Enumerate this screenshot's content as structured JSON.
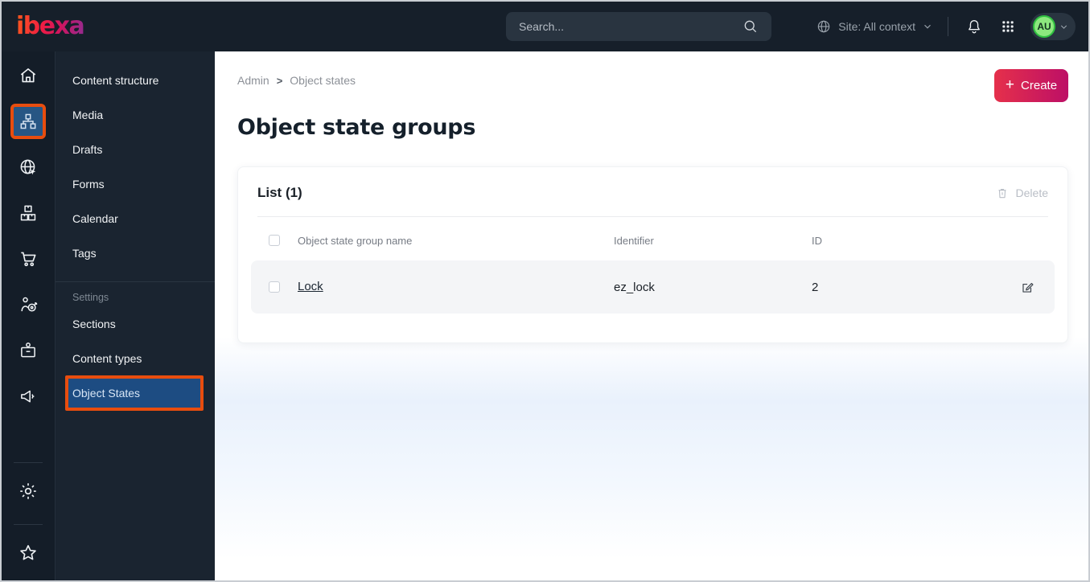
{
  "topbar": {
    "logo": "ibexa",
    "search_placeholder": "Search...",
    "site_context": "Site: All context",
    "avatar_initials": "AU"
  },
  "sidebar": {
    "icons": [
      "home",
      "content-structure",
      "site",
      "product-catalog",
      "commerce",
      "personalization",
      "customers",
      "marketing",
      "settings",
      "bookmarks"
    ],
    "active_icon": "content-structure"
  },
  "menu": {
    "items": [
      "Content structure",
      "Media",
      "Drafts",
      "Forms",
      "Calendar",
      "Tags"
    ],
    "section_label": "Settings",
    "settings_items": [
      "Sections",
      "Content types",
      "Object States"
    ],
    "active_item": "Object States"
  },
  "main": {
    "breadcrumb": [
      "Admin",
      "Object states"
    ],
    "breadcrumb_separator": ">",
    "create_label": "Create",
    "plus_glyph": "+",
    "title": "Object state groups",
    "card": {
      "title": "List (1)",
      "delete_label": "Delete",
      "columns": [
        "Object state group name",
        "Identifier",
        "ID"
      ],
      "rows": [
        {
          "name": "Lock",
          "identifier": "ez_lock",
          "id": "2"
        }
      ]
    }
  },
  "colors": {
    "topbar_bg": "#161f2a",
    "sidebar_bg": "#141d28",
    "menu_bg": "#1a2430",
    "accent_gradient_start": "#e5304b",
    "accent_gradient_end": "#bd0f66",
    "active_blue": "#1d4c82",
    "annotation_orange": "#e84d0e",
    "avatar_green": "#8ce87e",
    "row_bg": "#f4f5f7"
  }
}
